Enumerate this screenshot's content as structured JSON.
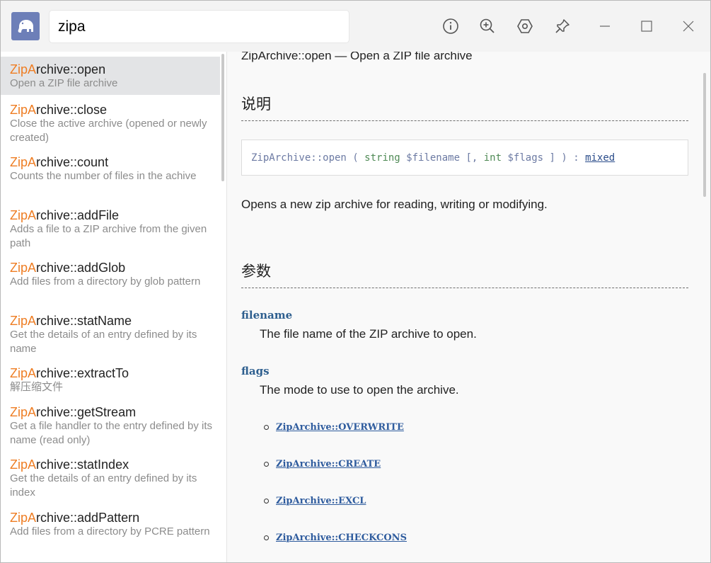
{
  "search": {
    "value": "zipa"
  },
  "results": [
    {
      "hl": "ZipA",
      "rest": "rchive::open",
      "desc": "Open a ZIP file archive"
    },
    {
      "hl": "ZipA",
      "rest": "rchive::close",
      "desc": "Close the active archive (opened or newly created)"
    },
    {
      "hl": "ZipA",
      "rest": "rchive::count",
      "desc": "Counts the number of files in the achive"
    },
    {
      "hl": "ZipA",
      "rest": "rchive::addFile",
      "desc": "Adds a file to a ZIP archive from the given path"
    },
    {
      "hl": "ZipA",
      "rest": "rchive::addGlob",
      "desc": "Add files from a directory by glob pattern"
    },
    {
      "hl": "ZipA",
      "rest": "rchive::statName",
      "desc": "Get the details of an entry defined by its name"
    },
    {
      "hl": "ZipA",
      "rest": "rchive::extractTo",
      "desc": "解压缩文件"
    },
    {
      "hl": "ZipA",
      "rest": "rchive::getStream",
      "desc": "Get a file handler to the entry defined by its name (read only)"
    },
    {
      "hl": "ZipA",
      "rest": "rchive::statIndex",
      "desc": "Get the details of an entry defined by its index"
    },
    {
      "hl": "ZipA",
      "rest": "rchive::addPattern",
      "desc": "Add files from a directory by PCRE pattern"
    }
  ],
  "doc": {
    "refname": "ZipArchive::open — Open a ZIP file archive",
    "section_description": "说明",
    "signature": {
      "method": "ZipArchive::open",
      "open_paren": " ( ",
      "type1": "string",
      "param1": " $filename",
      "opt_open": " [, ",
      "type2": "int",
      "param2": " $flags",
      "opt_close": " ] ) : ",
      "return_type": "mixed"
    },
    "description": "Opens a new zip archive for reading, writing or modifying.",
    "section_parameters": "参数",
    "params": [
      {
        "name": "filename",
        "desc": "The file name of the ZIP archive to open."
      },
      {
        "name": "flags",
        "desc": "The mode to use to open the archive."
      }
    ],
    "flag_constants": [
      "ZipArchive::OVERWRITE",
      "ZipArchive::CREATE",
      "ZipArchive::EXCL",
      "ZipArchive::CHECKCONS"
    ]
  },
  "colors": {
    "highlight": "#ee7d23",
    "logo_bg": "#6d7fb8",
    "link": "#2f5c9e",
    "selected_row": "#e3e4e6"
  },
  "icons": {
    "logo": "elephant-icon",
    "toolbar": [
      "info-icon",
      "zoom-in-icon",
      "settings-icon",
      "pin-icon"
    ],
    "window": [
      "minimize-icon",
      "maximize-icon",
      "close-icon"
    ]
  }
}
